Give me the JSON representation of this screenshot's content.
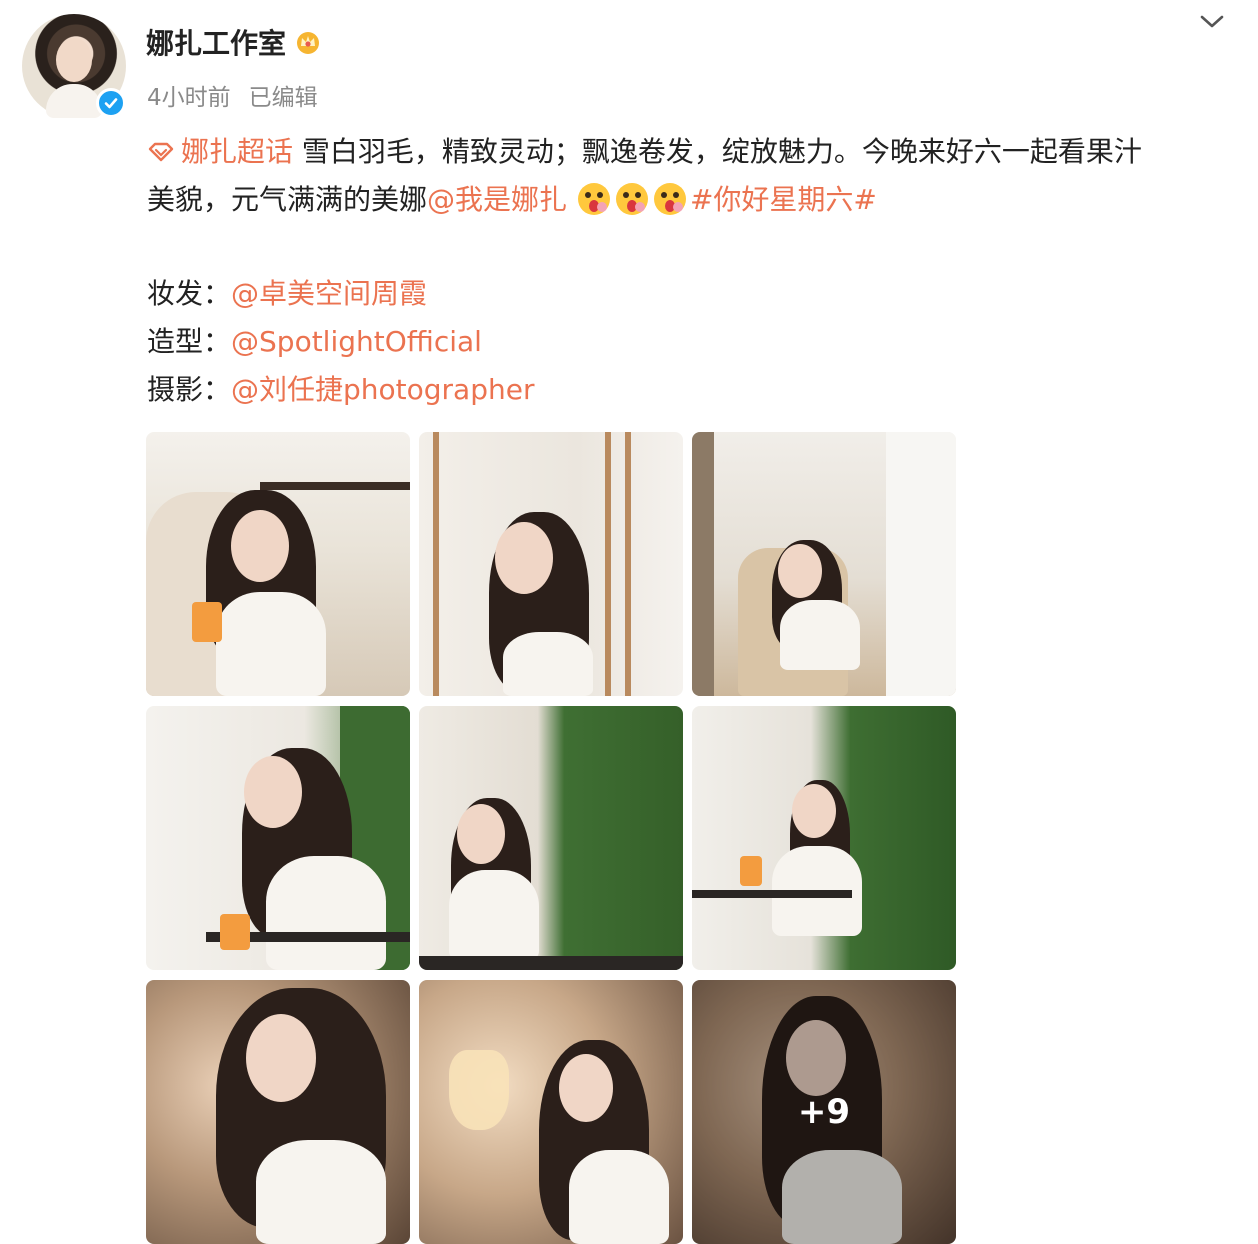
{
  "header": {
    "account_name": "娜扎工作室",
    "time_ago": "4小时前",
    "edited": "已编辑",
    "icons": [
      "crown-icon",
      "verified-icon",
      "chevron-down-icon"
    ]
  },
  "post": {
    "super_topic": "娜扎超话",
    "text_line1": "雪白羽毛，精致灵动；飘逸卷发，绽放魅力。今晚来好六一起看果汁",
    "text_line2_prefix": "美貌，元气满满的美娜",
    "mention_main": "@我是娜扎",
    "hashtag": "#你好星期六#",
    "emoji_icon": "surprised-face-emoji"
  },
  "credits": [
    {
      "label": "妆发：",
      "handle": "@卓美空间周霞"
    },
    {
      "label": "造型：",
      "handle": "@SpotlightOfficial"
    },
    {
      "label": "摄影：",
      "handle": "@刘任捷photographer"
    }
  ],
  "gallery": {
    "more_count": "+9",
    "colors": {
      "link": "#eb7350",
      "verified": "#1da1f2"
    }
  }
}
